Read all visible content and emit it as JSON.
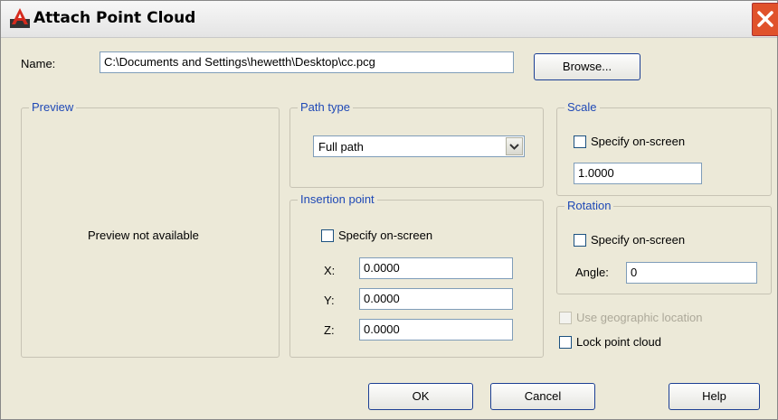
{
  "window": {
    "title": "Attach Point Cloud"
  },
  "name_row": {
    "label": "Name:",
    "value": "C:\\Documents and Settings\\hewetth\\Desktop\\cc.pcg",
    "browse_label": "Browse..."
  },
  "preview": {
    "legend": "Preview",
    "message": "Preview not available"
  },
  "path_type": {
    "legend": "Path type",
    "selected": "Full path"
  },
  "insertion": {
    "legend": "Insertion point",
    "specify_label": "Specify on-screen",
    "x_label": "X:",
    "x_value": "0.0000",
    "y_label": "Y:",
    "y_value": "0.0000",
    "z_label": "Z:",
    "z_value": "0.0000"
  },
  "scale": {
    "legend": "Scale",
    "specify_label": "Specify on-screen",
    "value": "1.0000"
  },
  "rotation": {
    "legend": "Rotation",
    "specify_label": "Specify on-screen",
    "angle_label": "Angle:",
    "angle_value": "0"
  },
  "options": {
    "geo_label": "Use geographic location",
    "lock_label": "Lock point cloud"
  },
  "buttons": {
    "ok": "OK",
    "cancel": "Cancel",
    "help": "Help"
  }
}
